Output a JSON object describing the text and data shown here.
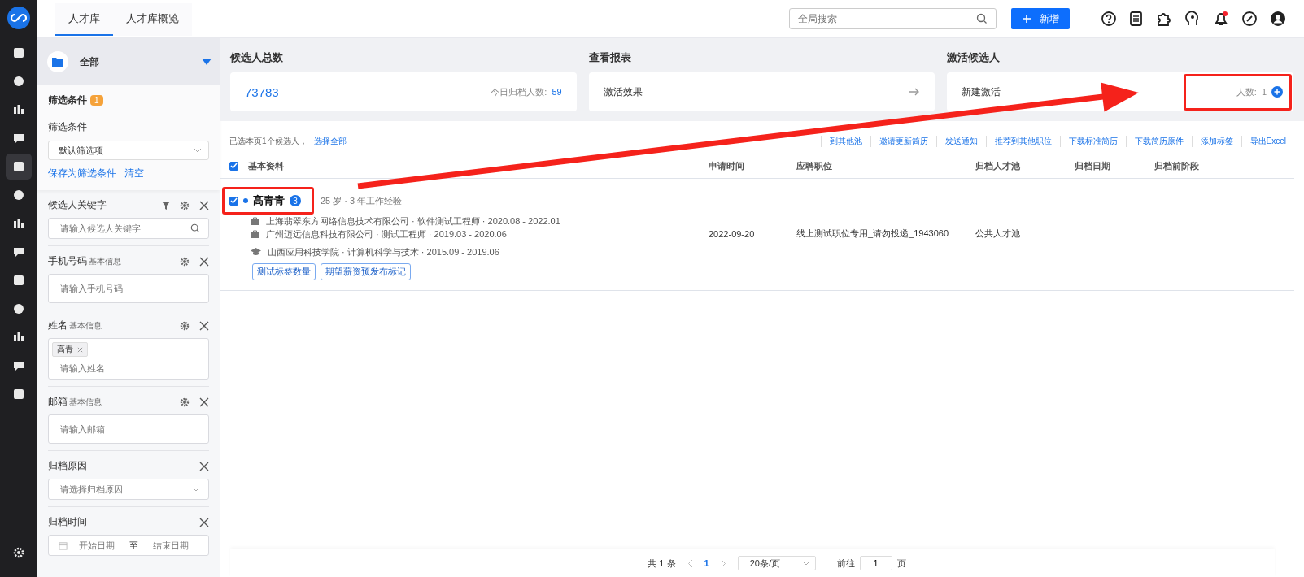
{
  "nav_items": [
    {
      "selected": false
    },
    {
      "selected": false
    },
    {
      "selected": false
    },
    {
      "selected": false
    },
    {
      "selected": true
    },
    {
      "selected": false
    },
    {
      "selected": false
    },
    {
      "selected": false
    },
    {
      "selected": false
    },
    {
      "selected": false
    },
    {
      "selected": false
    },
    {
      "selected": false
    },
    {
      "selected": false
    }
  ],
  "top_tabs": [
    {
      "label": "人才库",
      "selected": true
    },
    {
      "label": "人才库概览",
      "selected": false
    }
  ],
  "global_search": {
    "placeholder": "全局搜索"
  },
  "new_button": {
    "label": "新增"
  },
  "notifications": {
    "unread": true
  },
  "folder": {
    "label": "全部"
  },
  "filters": {
    "title": "筛选条件",
    "count": "1",
    "preset_label": "筛选条件",
    "preset_value": "默认筛选项",
    "save_link": "保存为筛选条件",
    "clear_link": "清空"
  },
  "filter_fields": [
    {
      "kind": "search",
      "label": "候选人关键字",
      "configurable": true,
      "placeholder": "请输入候选人关键字"
    },
    {
      "kind": "text",
      "label": "手机号码",
      "sublabel": "基本信息",
      "configurable": true,
      "placeholder": "请输入手机号码"
    },
    {
      "kind": "tags",
      "label": "姓名",
      "sublabel": "基本信息",
      "configurable": true,
      "tags": [
        "高青"
      ],
      "placeholder": "请输入姓名"
    },
    {
      "kind": "text",
      "label": "邮箱",
      "sublabel": "基本信息",
      "configurable": true,
      "placeholder": "请输入邮箱"
    },
    {
      "kind": "select",
      "label": "归档原因",
      "configurable": false,
      "placeholder": "请选择归档原因"
    },
    {
      "kind": "daterange",
      "label": "归档时间",
      "configurable": false,
      "start_placeholder": "开始日期",
      "separator": "至",
      "end_placeholder": "结束日期"
    }
  ],
  "stats": [
    {
      "kind": "total",
      "title": "候选人总数",
      "value": "73783",
      "side_label": "今日归档人数:",
      "side_value": "59"
    },
    {
      "kind": "report",
      "title": "查看报表",
      "label": "激活效果"
    },
    {
      "kind": "activate",
      "title": "激活候选人",
      "label": "新建激活",
      "side_label": "人数:",
      "side_value": "1",
      "highlighted": true
    }
  ],
  "selection": {
    "text": "已选本页1个候选人，",
    "link": "选择全部"
  },
  "actions": [
    "到其他池",
    "邀请更新简历",
    "发送通知",
    "推荐到其他职位",
    "下载标准简历",
    "下载简历原件",
    "添加标签",
    "导出Excel"
  ],
  "table": {
    "all_checked": true,
    "columns": [
      "基本资料",
      "申请时间",
      "应聘职位",
      "归档人才池",
      "归档日期",
      "归档前阶段"
    ],
    "rows": [
      {
        "checked": true,
        "highlighted": true,
        "name": "高青青",
        "badge": "3",
        "summary": "25 岁 · 3 年工作经验",
        "history": [
          {
            "kind": "work",
            "text": "上海翡翠东方网络信息技术有限公司 · 软件测试工程师 · 2020.08 - 2022.01"
          },
          {
            "kind": "work",
            "text": "广州迈远信息科技有限公司 · 测试工程师 · 2019.03 - 2020.06"
          },
          {
            "kind": "education",
            "text": "山西应用科技学院 · 计算机科学与技术 · 2015.09 - 2019.06"
          }
        ],
        "tags": [
          "测试标签数量",
          "期望薪资预发布标记"
        ],
        "applied": "2022-09-20",
        "position": "线上测试职位专用_请勿投递_1943060",
        "pool": "公共人才池"
      }
    ]
  },
  "pagination": {
    "total": "共 1 条",
    "pages": [
      {
        "label": "1",
        "selected": true
      }
    ],
    "page_size": "20条/页",
    "goto_label": "前往",
    "goto_value": "1",
    "goto_suffix": "页"
  },
  "annotation_arrow": true
}
